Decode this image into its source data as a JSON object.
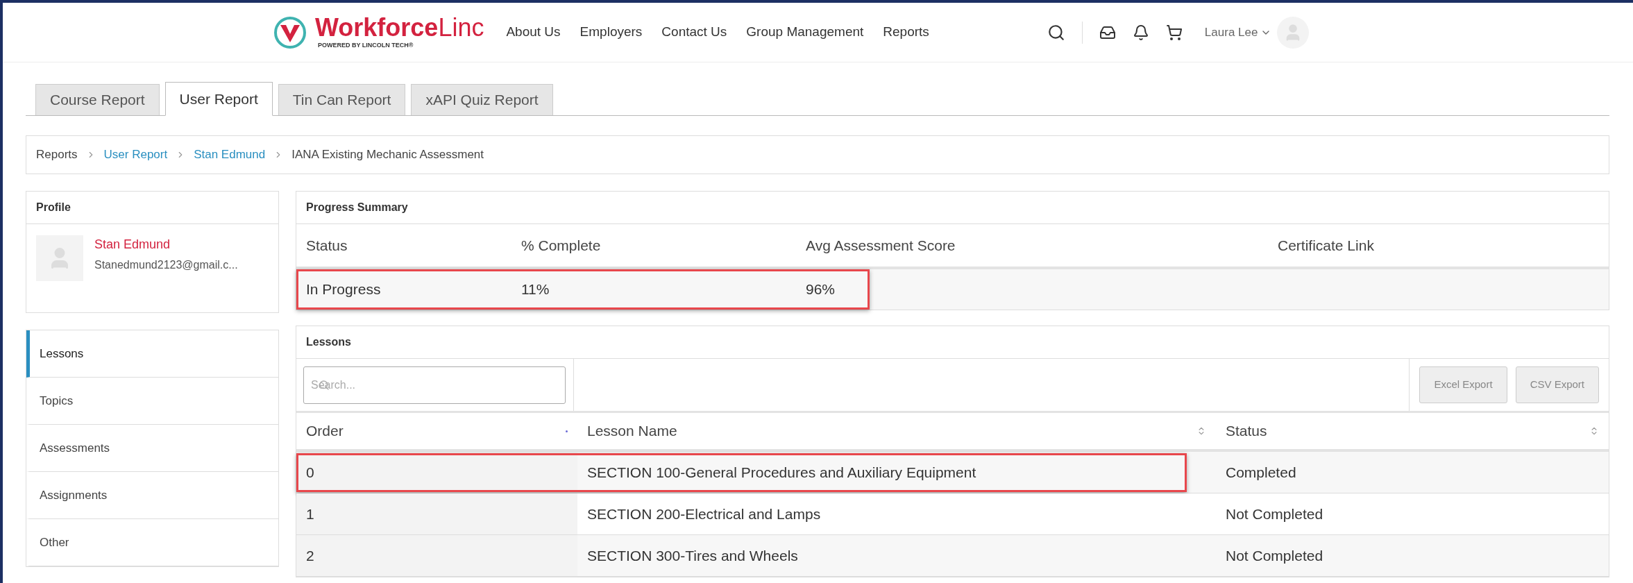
{
  "logo": {
    "name_bold": "Workforce",
    "name_light": "Linc",
    "tagline": "POWERED BY LINCOLN TECH®"
  },
  "nav": [
    "About Us",
    "Employers",
    "Contact Us",
    "Group Management",
    "Reports"
  ],
  "user": {
    "name": "Laura Lee"
  },
  "tabs": [
    {
      "label": "Course Report",
      "selected": false
    },
    {
      "label": "User Report",
      "selected": true
    },
    {
      "label": "Tin Can Report",
      "selected": false
    },
    {
      "label": "xAPI Quiz Report",
      "selected": false
    }
  ],
  "breadcrumb": [
    {
      "label": "Reports",
      "link": false
    },
    {
      "label": "User Report",
      "link": true
    },
    {
      "label": "Stan Edmund",
      "link": true
    },
    {
      "label": "IANA Existing Mechanic Assessment",
      "link": false
    }
  ],
  "profile": {
    "title": "Profile",
    "name": "Stan Edmund",
    "email": "Stanedmund2123@gmail.c..."
  },
  "sidebar": {
    "items": [
      {
        "label": "Lessons",
        "selected": true
      },
      {
        "label": "Topics",
        "selected": false
      },
      {
        "label": "Assessments",
        "selected": false
      },
      {
        "label": "Assignments",
        "selected": false
      },
      {
        "label": "Other",
        "selected": false
      }
    ]
  },
  "progress_summary": {
    "title": "Progress Summary",
    "columns": [
      "Status",
      "% Complete",
      "Avg Assessment Score",
      "Certificate Link"
    ],
    "row": {
      "highlighted": true,
      "cells": [
        "In Progress",
        "11%",
        "96%"
      ]
    }
  },
  "lessons": {
    "title": "Lessons",
    "search": {
      "placeholder": "Search..."
    },
    "buttons": [
      "Excel Export",
      "CSV Export"
    ],
    "columns": [
      {
        "label": "Order",
        "sorted": true
      },
      {
        "label": "Lesson Name",
        "sorted": false
      },
      {
        "label": "Status",
        "sorted": false
      }
    ],
    "rows": [
      {
        "highlighted": true,
        "cells": [
          "0",
          "SECTION 100-General Procedures and Auxiliary Equipment",
          "Completed"
        ]
      },
      {
        "highlighted": false,
        "cells": [
          "1",
          "SECTION 200-Electrical and Lamps",
          "Not Completed"
        ]
      },
      {
        "highlighted": false,
        "cells": [
          "2",
          "SECTION 300-Tires and Wheels",
          "Not Completed"
        ]
      }
    ]
  }
}
